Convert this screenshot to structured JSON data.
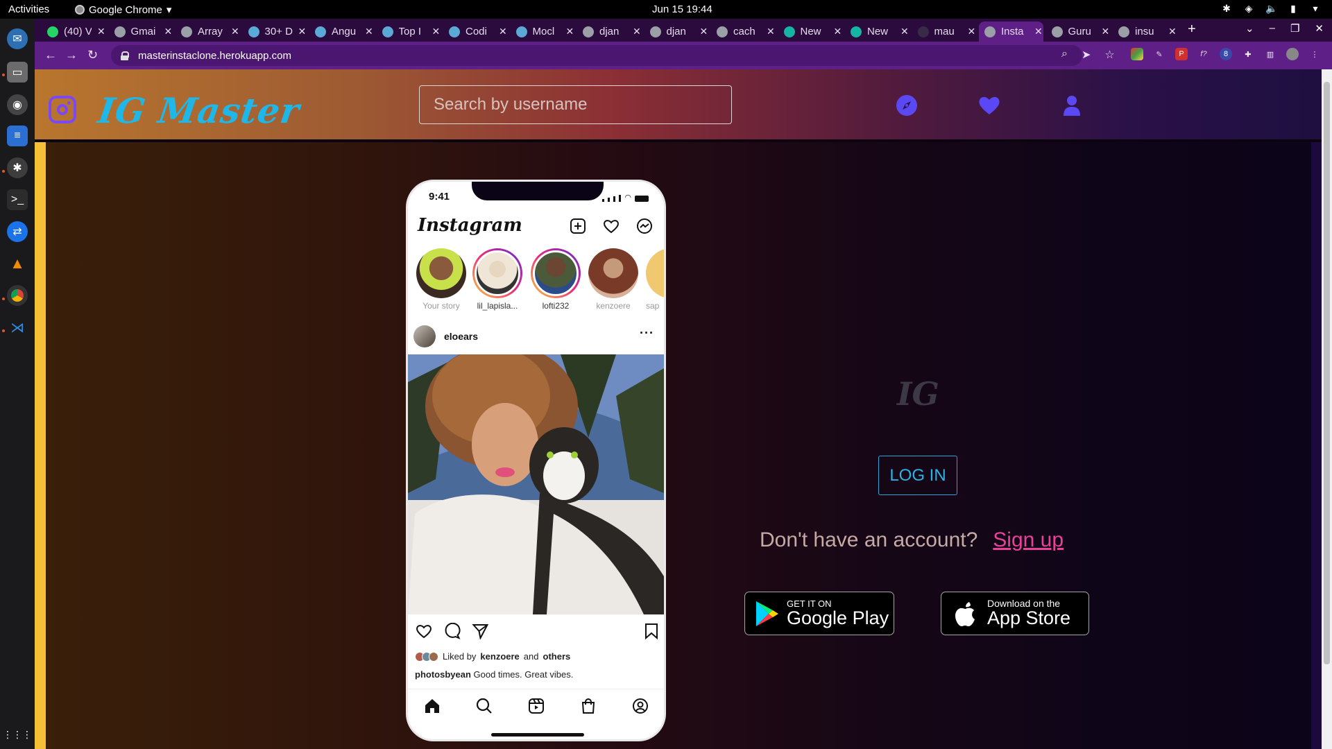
{
  "os": {
    "activities": "Activities",
    "app_name": "Google Chrome",
    "clock": "Jun 15  19:44"
  },
  "browser": {
    "tabs": [
      {
        "label": "(40) V",
        "color": "#25d366"
      },
      {
        "label": "Gmai",
        "color": "#9aa0a6"
      },
      {
        "label": "Array",
        "color": "#9aa0a6"
      },
      {
        "label": "30+ D",
        "color": "#5aa9d6"
      },
      {
        "label": "Angu",
        "color": "#5aa9d6"
      },
      {
        "label": "Top I",
        "color": "#5aa9d6"
      },
      {
        "label": "Codi",
        "color": "#5aa9d6"
      },
      {
        "label": "Mocl",
        "color": "#5aa9d6"
      },
      {
        "label": "djan",
        "color": "#9aa0a6"
      },
      {
        "label": "djan",
        "color": "#9aa0a6"
      },
      {
        "label": "cach",
        "color": "#9aa0a6"
      },
      {
        "label": "New",
        "color": "#17b3a3"
      },
      {
        "label": "New",
        "color": "#17b3a3"
      },
      {
        "label": "mau",
        "color": "#3a2a4a"
      },
      {
        "label": "Insta",
        "color": "#9aa0a6",
        "active": true
      },
      {
        "label": "Guru",
        "color": "#9aa0a6"
      },
      {
        "label": "insu",
        "color": "#9aa0a6"
      }
    ],
    "url": "masterinstaclone.herokuapp.com"
  },
  "site": {
    "title": "IG Master",
    "search_placeholder": "Search by username",
    "accent": "#5b48f5"
  },
  "phone": {
    "time": "9:41",
    "app_wordmark": "Instagram",
    "stories": [
      {
        "name": "Your story"
      },
      {
        "name": "lil_lapisla..."
      },
      {
        "name": "lofti232"
      },
      {
        "name": "kenzoere"
      },
      {
        "name": "sap"
      }
    ],
    "post": {
      "username": "eloears",
      "more": "···",
      "liked_prefix": "Liked by",
      "liked_user": "kenzoere",
      "liked_and": "and",
      "liked_others": "others",
      "caption_user": "photosbyean",
      "caption_text": "Good times. Great vibes."
    }
  },
  "auth": {
    "logo_text": "IG",
    "login_label": "LOG IN",
    "no_account_text": "Don't have an account?",
    "signup_label": "Sign up"
  },
  "stores": {
    "google_small": "GET IT ON",
    "google_big": "Google Play",
    "apple_small": "Download on the",
    "apple_big": "App Store"
  }
}
